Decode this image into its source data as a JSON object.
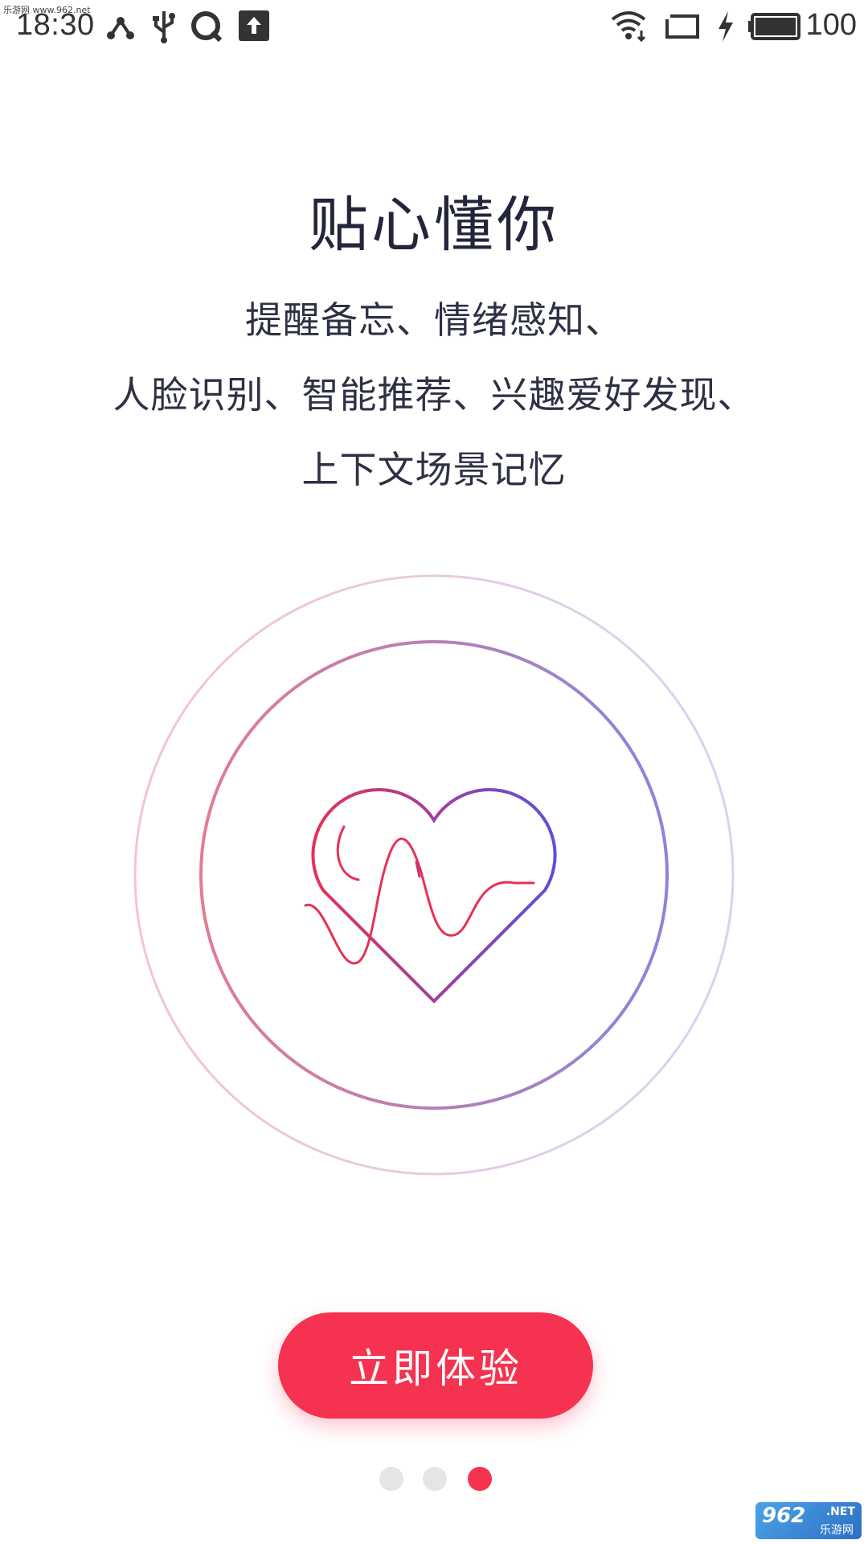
{
  "watermark_top": "乐游网 www.962.net",
  "status_bar": {
    "time": "18:30",
    "battery": "100",
    "icons": [
      "share-nodes-icon",
      "usb-icon",
      "q-app-icon",
      "upload-icon",
      "wifi-icon",
      "screen-cast-icon",
      "charging-bolt-icon",
      "battery-icon"
    ]
  },
  "title": "贴心懂你",
  "description": {
    "line1": "提醒备忘、情绪感知、",
    "line2": "人脸识别、智能推荐、兴趣爱好发现、",
    "line3": "上下文场景记忆"
  },
  "illustration": {
    "icon": "heart-pulse-icon",
    "gradient_start": "#e63156",
    "gradient_end": "#5b4fe0"
  },
  "cta_button": "立即体验",
  "page_indicator": {
    "count": 3,
    "active_index": 2
  },
  "colors": {
    "accent": "#f5324f",
    "title_text": "#23253a",
    "dot_inactive": "#e5e5e5"
  },
  "watermark_bottom": {
    "number": "962",
    "suffix": ".NET",
    "name": "乐游网"
  }
}
